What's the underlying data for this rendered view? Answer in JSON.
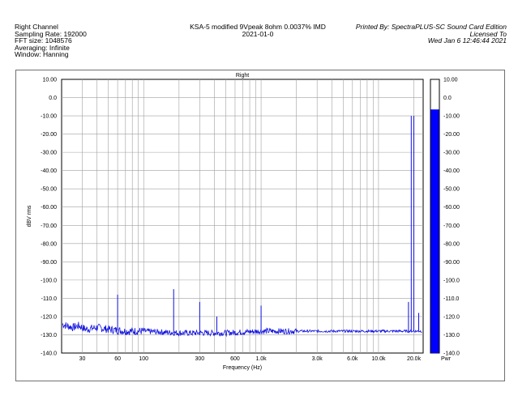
{
  "header": {
    "left": [
      "Right Channel",
      "Sampling Rate: 192000",
      "FFT size: 1048576",
      "Averaging: Infinite",
      "Window: Hanning"
    ],
    "center": [
      "KSA-5 modified 9Vpeak 8ohm 0.0037% IMD",
      "2021-01-0"
    ],
    "right": [
      "Printed By: SpectraPLUS-SC Sound Card Edition",
      "Licensed To",
      "Wed Jan  6 12:46:44 2021"
    ]
  },
  "colors": {
    "trace": "#1010e0",
    "grid": "#a0a0a0",
    "bar": "#0000ff"
  },
  "chart_data": {
    "type": "line",
    "title": "Right",
    "xlabel": "Frequency (Hz)",
    "ylabel": "dBV rms",
    "x_scale": "log",
    "xlim": [
      20,
      24000
    ],
    "ylim": [
      -140,
      10
    ],
    "grid": true,
    "x_ticks": [
      {
        "v": 30,
        "label": "30"
      },
      {
        "v": 60,
        "label": "60"
      },
      {
        "v": 100,
        "label": "100"
      },
      {
        "v": 300,
        "label": "300"
      },
      {
        "v": 600,
        "label": "600"
      },
      {
        "v": 1000,
        "label": "1.0k"
      },
      {
        "v": 3000,
        "label": "3.0k"
      },
      {
        "v": 6000,
        "label": "6.0k"
      },
      {
        "v": 10000,
        "label": "10.0k"
      },
      {
        "v": 20000,
        "label": "20.0k"
      }
    ],
    "y_ticks": [
      "10.00",
      "0.0",
      "-10.00",
      "-20.00",
      "-30.00",
      "-40.00",
      "-50.00",
      "-60.00",
      "-70.00",
      "-80.00",
      "-90.00",
      "-100.0",
      "-110.0",
      "-120.0",
      "-130.0",
      "-140.0"
    ],
    "noise_floor": [
      {
        "x": 20,
        "y": -124
      },
      {
        "x": 22,
        "y": -125
      },
      {
        "x": 25,
        "y": -126
      },
      {
        "x": 28,
        "y": -125
      },
      {
        "x": 32,
        "y": -127
      },
      {
        "x": 40,
        "y": -126
      },
      {
        "x": 50,
        "y": -127
      },
      {
        "x": 70,
        "y": -128
      },
      {
        "x": 100,
        "y": -128
      },
      {
        "x": 200,
        "y": -129
      },
      {
        "x": 500,
        "y": -129
      },
      {
        "x": 1000,
        "y": -128
      },
      {
        "x": 3000,
        "y": -128
      },
      {
        "x": 10000,
        "y": -128
      },
      {
        "x": 24000,
        "y": -128
      }
    ],
    "peaks": [
      {
        "x": 60,
        "y": -108
      },
      {
        "x": 180,
        "y": -105
      },
      {
        "x": 300,
        "y": -112
      },
      {
        "x": 420,
        "y": -120
      },
      {
        "x": 1000,
        "y": -114
      },
      {
        "x": 18000,
        "y": -112
      },
      {
        "x": 19000,
        "y": -10
      },
      {
        "x": 20000,
        "y": -10
      },
      {
        "x": 22000,
        "y": -118
      }
    ],
    "level_bar": {
      "label": "Pwr",
      "value": -6.5,
      "ticks": [
        "10.00",
        "0.0",
        "-10.00",
        "-20.00",
        "-30.00",
        "-40.00",
        "-50.00",
        "-60.00",
        "-70.00",
        "-80.00",
        "-90.00",
        "-100.0",
        "-110.0",
        "-120.0",
        "-130.0",
        "-140.0"
      ]
    }
  }
}
